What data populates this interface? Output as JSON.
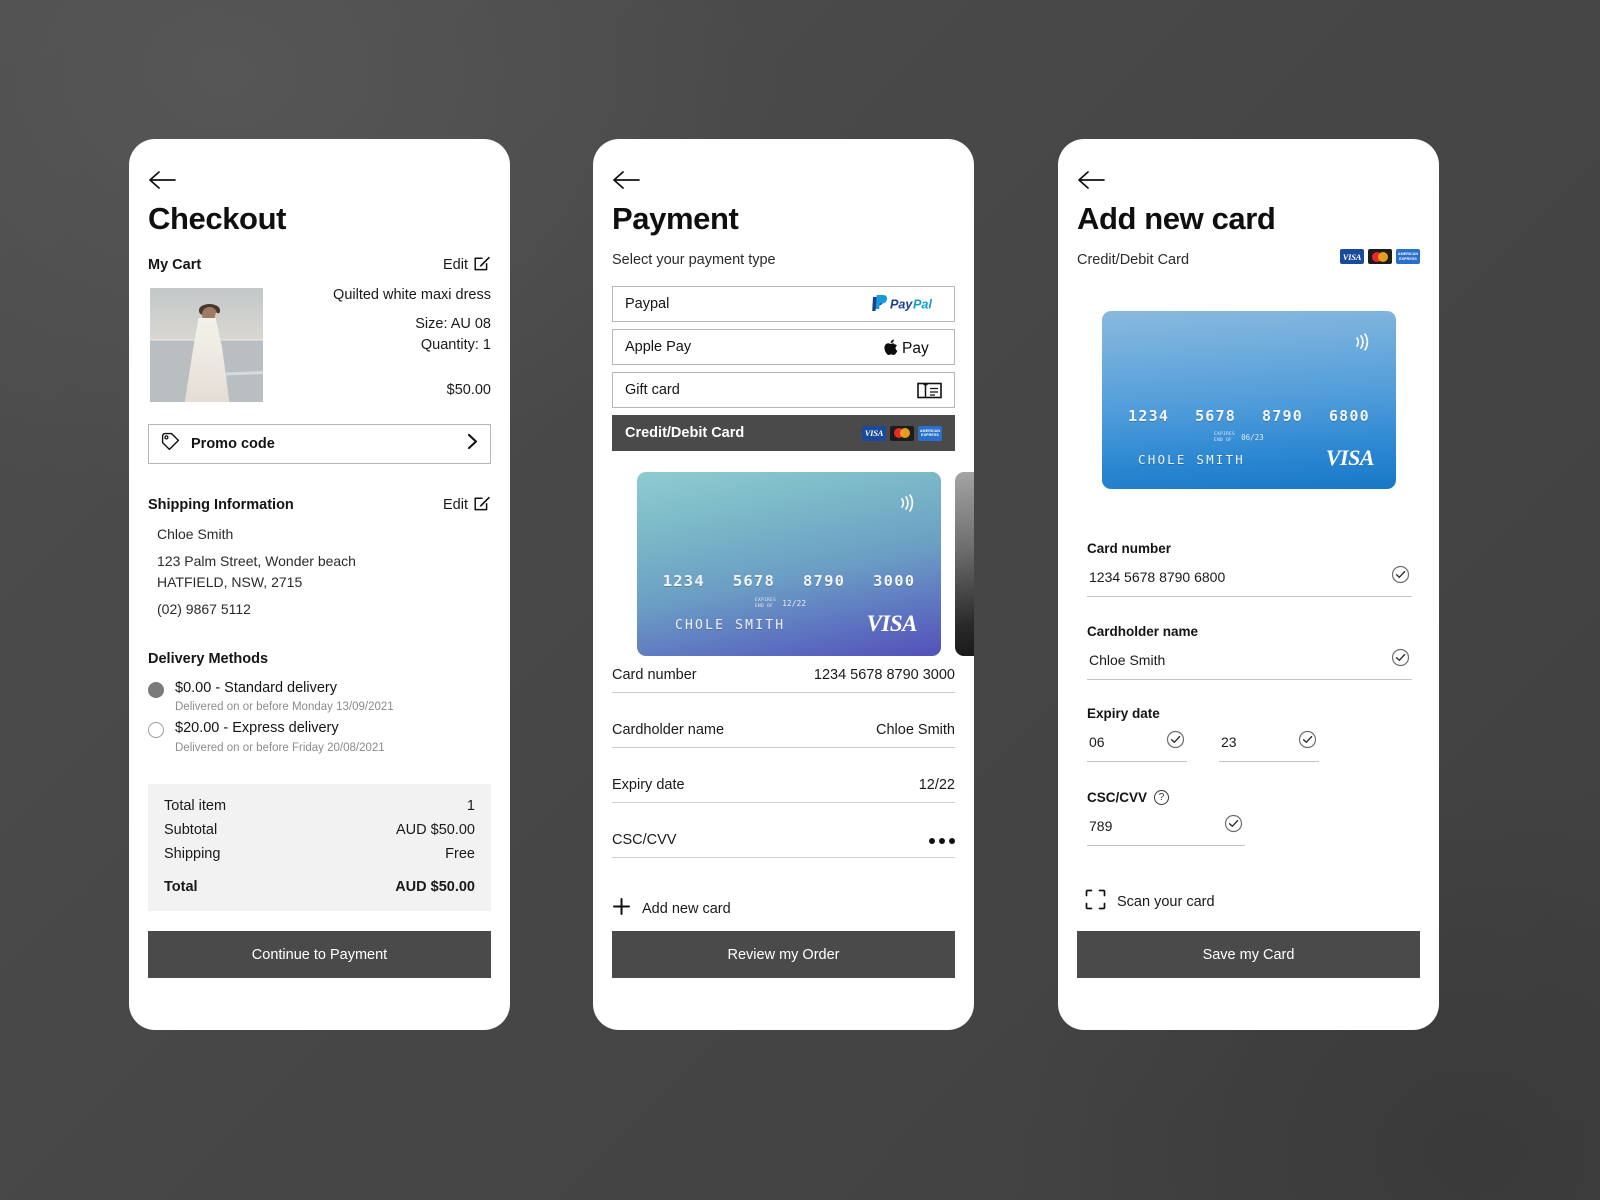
{
  "checkout": {
    "title": "Checkout",
    "back_icon": "arrow-left-icon",
    "cart": {
      "heading": "My Cart",
      "edit_label": "Edit",
      "edit_icon": "edit-pencil-icon",
      "item": {
        "title": "Quilted white maxi dress",
        "size": "Size: AU 08",
        "quantity": "Quantity: 1",
        "price": "$50.00",
        "image_alt": "woman-in-white-dress-by-ocean"
      }
    },
    "promo": {
      "label": "Promo code",
      "icon": "tag-icon",
      "chevron_icon": "chevron-right-icon"
    },
    "shipping": {
      "heading": "Shipping Information",
      "edit_label": "Edit",
      "name": "Chloe Smith",
      "address_line1": "123 Palm Street, Wonder beach",
      "address_line2": "HATFIELD, NSW, 2715",
      "phone": "(02) 9867 5112"
    },
    "delivery": {
      "heading": "Delivery Methods",
      "options": [
        {
          "label": "$0.00 - Standard delivery",
          "sub": "Delivered on or before Monday 13/09/2021",
          "selected": true
        },
        {
          "label": "$20.00 - Express delivery",
          "sub": "Delivered on or before Friday 20/08/2021",
          "selected": false
        }
      ]
    },
    "totals": {
      "rows": [
        {
          "label": "Total item",
          "value": "1"
        },
        {
          "label": "Subtotal",
          "value": "AUD $50.00"
        },
        {
          "label": "Shipping",
          "value": "Free"
        }
      ],
      "grand_label": "Total",
      "grand_value": "AUD $50.00"
    },
    "cta": "Continue to Payment"
  },
  "payment": {
    "title": "Payment",
    "subtitle": "Select your payment type",
    "options": [
      {
        "label": "Paypal",
        "brand": "paypal-logo"
      },
      {
        "label": "Apple Pay",
        "brand": "apple-pay-logo"
      },
      {
        "label": "Gift card",
        "brand": "gift-card-icon"
      },
      {
        "label": "Credit/Debit Card",
        "brand": "card-brand-logos",
        "selected": true
      }
    ],
    "card": {
      "digits": [
        "1234",
        "5678",
        "8790",
        "3000"
      ],
      "expires_label_line1": "EXPIRES",
      "expires_label_line2": "END OF",
      "expiry": "12/22",
      "holder": "CHOLE SMITH",
      "network": "VISA",
      "nfc_icon": "contactless-icon"
    },
    "details": [
      {
        "key": "Card number",
        "value": "1234 5678 8790 3000"
      },
      {
        "key": "Cardholder name",
        "value": "Chloe Smith"
      },
      {
        "key": "Expiry date",
        "value": "12/22"
      },
      {
        "key": "CSC/CVV",
        "value": "•••"
      }
    ],
    "add_new_card": "Add new card",
    "cta": "Review my Order"
  },
  "add_card": {
    "title": "Add new card",
    "subtitle": "Credit/Debit Card",
    "card": {
      "digits": [
        "1234",
        "5678",
        "8790",
        "6800"
      ],
      "expires_label_line1": "EXPIRES",
      "expires_label_line2": "END OF",
      "expiry": "06/23",
      "holder": "CHOLE SMITH",
      "network": "VISA",
      "nfc_icon": "contactless-icon"
    },
    "fields": {
      "card_number_label": "Card number",
      "card_number_value": "1234 5678 8790 6800",
      "cardholder_label": "Cardholder name",
      "cardholder_value": "Chloe Smith",
      "expiry_label": "Expiry date",
      "expiry_month": "06",
      "expiry_year": "23",
      "cvv_label": "CSC/CVV",
      "cvv_value": "789",
      "cvv_help_icon": "question-mark-icon",
      "valid_icon": "check-circle-icon"
    },
    "scan": {
      "label": "Scan your card",
      "icon": "scan-frame-icon"
    },
    "cta": "Save my Card"
  },
  "colors": {
    "cta_bg": "#4a4a4a",
    "page_bg": "#474747",
    "totals_bg": "#f2f2f2",
    "selected_option_bg": "#4a4a4a",
    "radio_selected": "#7a7a7a",
    "muted_text": "#8c8c8c"
  }
}
